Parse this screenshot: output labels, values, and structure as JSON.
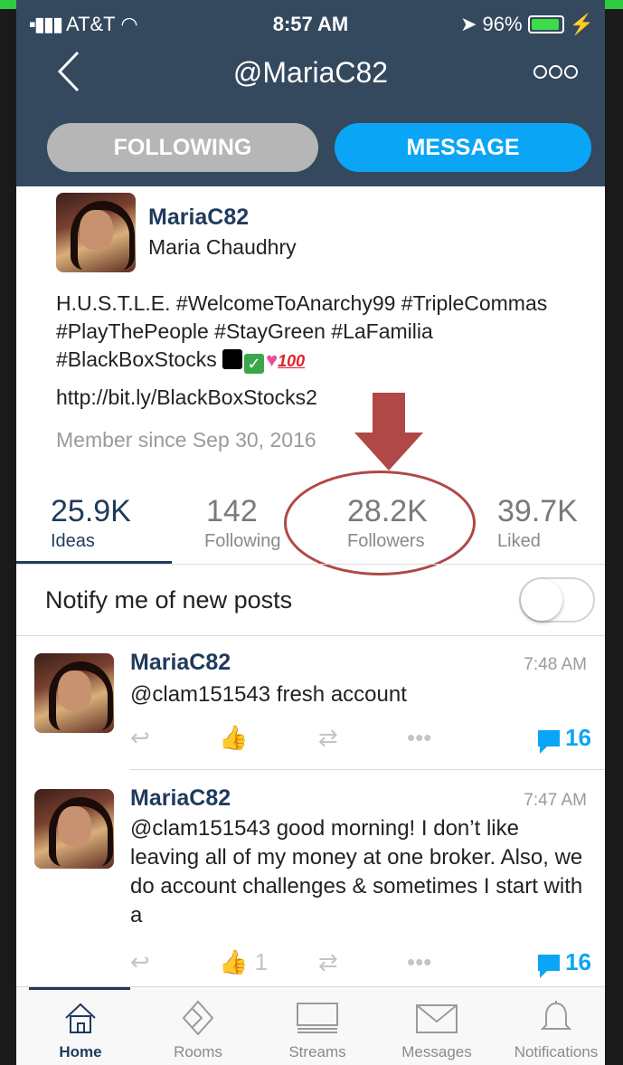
{
  "status_bar": {
    "carrier": "AT&T",
    "time": "8:57 AM",
    "battery": "96%"
  },
  "nav": {
    "title": "@MariaC82"
  },
  "buttons": {
    "following": "FOLLOWING",
    "message": "MESSAGE"
  },
  "profile": {
    "username": "MariaC82",
    "full_name": "Maria Chaudhry",
    "bio_text": "H.U.S.T.L.E. #WelcomeToAnarchy99 #TripleCommas #PlayThePeople #StayGreen #LaFamilia #BlackBoxStocks",
    "bio_emoji_100": "100",
    "link": "http://bit.ly/BlackBoxStocks2",
    "member_since": "Member since Sep 30, 2016"
  },
  "stats": [
    {
      "value": "25.9K",
      "label": "Ideas"
    },
    {
      "value": "142",
      "label": "Following"
    },
    {
      "value": "28.2K",
      "label": "Followers"
    },
    {
      "value": "39.7K",
      "label": "Liked"
    }
  ],
  "notify": {
    "label": "Notify me of new posts",
    "enabled": false
  },
  "posts": [
    {
      "username": "MariaC82",
      "time": "7:48 AM",
      "text": "@clam151543 fresh account",
      "likes": "",
      "comments": "16"
    },
    {
      "username": "MariaC82",
      "time": "7:47 AM",
      "text": "@clam151543 good morning! I don’t like leaving all of my money at one broker. Also, we do account challenges & sometimes I start with a",
      "likes": "1",
      "comments": "16"
    }
  ],
  "tabs": [
    {
      "label": "Home",
      "icon": "home-icon",
      "active": true
    },
    {
      "label": "Rooms",
      "icon": "rooms-icon",
      "active": false
    },
    {
      "label": "Streams",
      "icon": "streams-icon",
      "active": false
    },
    {
      "label": "Messages",
      "icon": "envelope-icon",
      "active": false
    },
    {
      "label": "Notifications",
      "icon": "bell-icon",
      "active": false
    }
  ],
  "colors": {
    "header": "#34495e",
    "accent": "#0ba5f5",
    "name": "#1f3a5c",
    "annotation": "#b04848"
  }
}
